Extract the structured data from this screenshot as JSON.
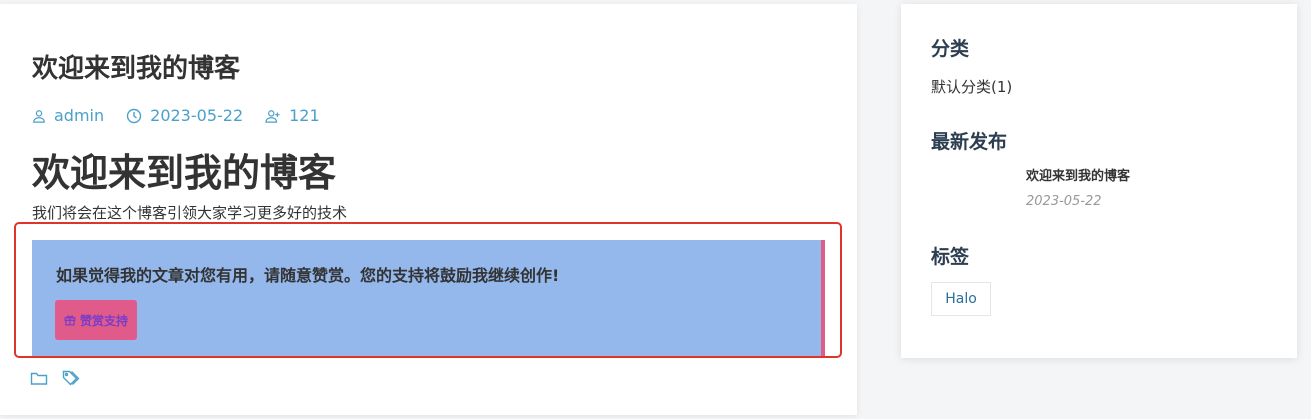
{
  "post": {
    "title": "欢迎来到我的博客",
    "author": "admin",
    "date": "2023-05-22",
    "views": "121",
    "heading": "欢迎来到我的博客",
    "body": "我们将会在这个博客引领大家学习更多好的技术"
  },
  "donate": {
    "message": "如果觉得我的文章对您有用，请随意赞赏。您的支持将鼓励我继续创作!",
    "button_label": "赞赏支持"
  },
  "sidebar": {
    "categories_heading": "分类",
    "categories": [
      {
        "label": "默认分类(1)"
      }
    ],
    "recent_heading": "最新发布",
    "recent": [
      {
        "title": "欢迎来到我的博客",
        "date": "2023-05-22"
      }
    ],
    "tags_heading": "标签",
    "tags": [
      {
        "label": "Halo"
      }
    ]
  },
  "colors": {
    "accent": "#4aa0c9",
    "donate_bg": "#94b7ec",
    "donate_button": "#e05a8a",
    "highlight_border": "#e0332a"
  },
  "icons": [
    "user-icon",
    "clock-icon",
    "views-icon",
    "gift-icon",
    "folder-icon",
    "tag-icon"
  ]
}
